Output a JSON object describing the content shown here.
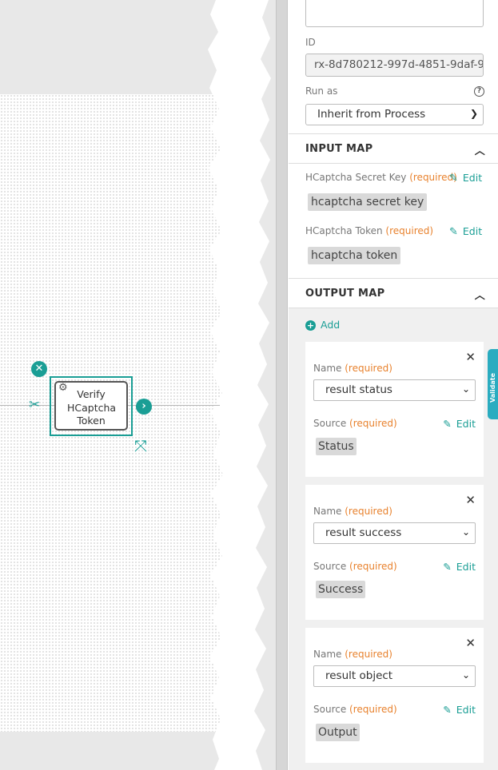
{
  "canvas": {
    "task_label": "Verify HCaptcha Token",
    "remove_symbol": "✕",
    "connect_symbol": "›"
  },
  "panel": {
    "id_label": "ID",
    "id_value": "rx-8d780212-997d-4851-9daf-9",
    "run_as_label": "Run as",
    "run_as_value": "Inherit from Process",
    "help_symbol": "?",
    "input_map": {
      "title": "INPUT MAP",
      "items": [
        {
          "label": "HCaptcha Secret Key",
          "required": "(required)",
          "edit": "Edit",
          "value": "hcaptcha secret key"
        },
        {
          "label": "HCaptcha Token",
          "required": "(required)",
          "edit": "Edit",
          "value": "hcaptcha token"
        }
      ]
    },
    "output_map": {
      "title": "OUTPUT MAP",
      "add_label": "Add",
      "cards": [
        {
          "name_label": "Name",
          "required": "(required)",
          "name_value": "result status",
          "source_label": "Source",
          "source_required": "(required)",
          "edit": "Edit",
          "source_value": "Status"
        },
        {
          "name_label": "Name",
          "required": "(required)",
          "name_value": "result success",
          "source_label": "Source",
          "source_required": "(required)",
          "edit": "Edit",
          "source_value": "Success"
        },
        {
          "name_label": "Name",
          "required": "(required)",
          "name_value": "result object",
          "source_label": "Source",
          "source_required": "(required)",
          "edit": "Edit",
          "source_value": "Output"
        }
      ]
    },
    "side_tab": "Validate"
  },
  "colors": {
    "accent": "#1a9e95",
    "required": "#e8822e",
    "side_tab": "#2aacc0"
  }
}
